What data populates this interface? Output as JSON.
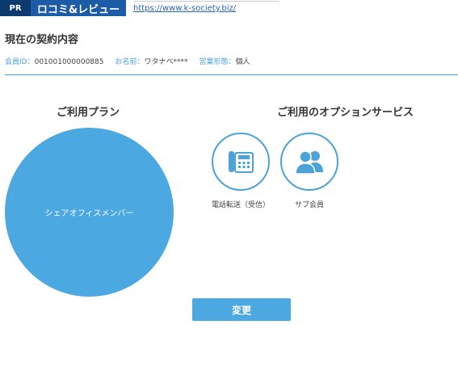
{
  "header": {
    "pr_badge": "PR",
    "review_label": "ロコミ&レビュー",
    "url": "https://www.k-society.biz/"
  },
  "page": {
    "title": "現在の契約内容"
  },
  "member": {
    "id_label": "会員ID：",
    "id_value": "001001000000885",
    "name_label": "お名前：",
    "name_value": "ワタナベ****",
    "type_label": "営業形態：",
    "type_value": "個人"
  },
  "plan": {
    "heading": "ご利用プラン",
    "name": "シェアオフィスメンバー"
  },
  "options": {
    "heading": "ご利用のオプションサービス",
    "items": [
      {
        "label": "電話転送（受信）",
        "icon": "telephone-icon"
      },
      {
        "label": "サブ会員",
        "icon": "users-icon"
      }
    ]
  },
  "actions": {
    "change_label": "変更"
  },
  "colors": {
    "accent": "#4ba8e0",
    "navy": "#0d3a6e",
    "review_blue": "#1c5ba6"
  }
}
